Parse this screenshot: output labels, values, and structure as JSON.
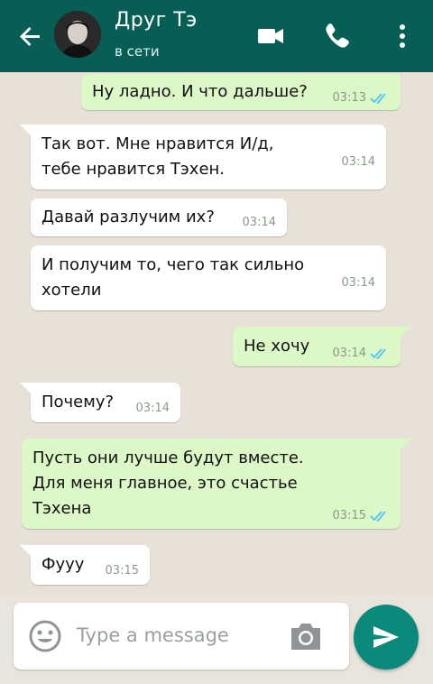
{
  "header": {
    "contact_name": "Друг Тэ",
    "contact_status": "в сети"
  },
  "messages": [
    {
      "direction": "out",
      "text": "Ну ладно. И что дальше?",
      "time": "03:13",
      "read": true
    },
    {
      "direction": "in",
      "text": "Так вот. Мне нравится И/д,\nтебе нравится Тэхен.",
      "time": "03:14"
    },
    {
      "direction": "in",
      "text": "Давай разлучим их?",
      "time": "03:14"
    },
    {
      "direction": "in",
      "text": "И получим то, чего так сильно\nхотели",
      "time": "03:14"
    },
    {
      "direction": "out",
      "text": "Не хочу",
      "time": "03:14",
      "read": true
    },
    {
      "direction": "in",
      "text": "Почему?",
      "time": "03:14"
    },
    {
      "direction": "out",
      "text": "Пусть они лучше будут вместе.\nДля меня главное, это счастье\nТэхена",
      "time": "03:15",
      "read": true
    },
    {
      "direction": "in",
      "text": "Фууу",
      "time": "03:15"
    }
  ],
  "input": {
    "placeholder": "Type a message"
  },
  "colors": {
    "header": "#075e54",
    "outgoing_bubble": "#dcf8c6",
    "incoming_bubble": "#ffffff",
    "read_ticks": "#4fc3f7",
    "send_button": "#0b8a7c"
  },
  "icons": [
    "back-arrow-icon",
    "video-call-icon",
    "phone-icon",
    "more-vert-icon",
    "emoji-icon",
    "camera-icon",
    "send-icon"
  ]
}
